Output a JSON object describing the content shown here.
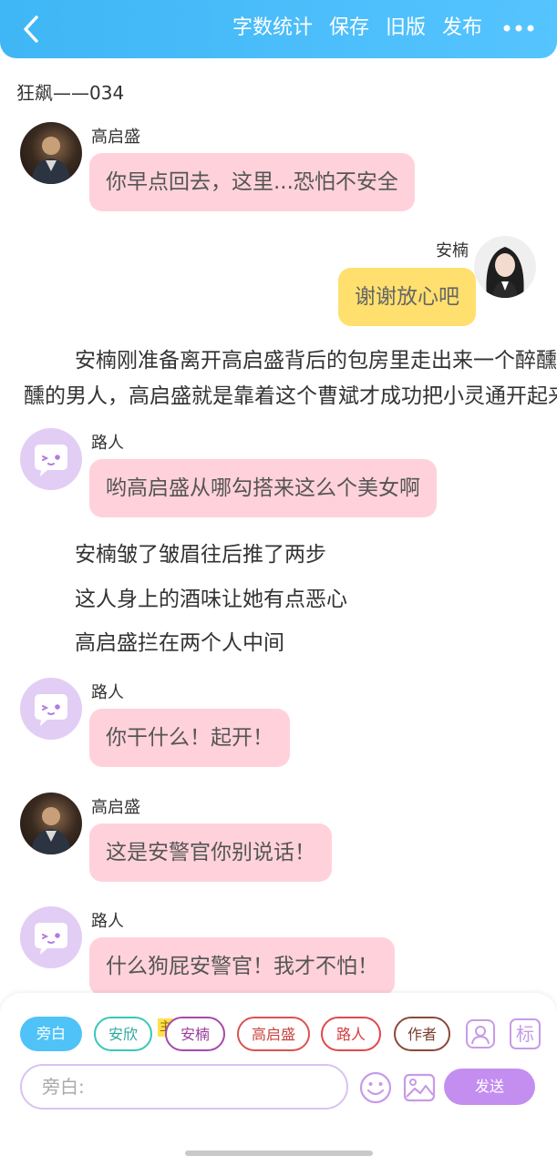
{
  "header": {
    "word_count": "字数统计",
    "save": "保存",
    "old_version": "旧版",
    "publish": "发布"
  },
  "chapter_title": "狂飙——034",
  "messages": {
    "m1": {
      "name": "高启盛",
      "text": "你早点回去，这里...恐怕不安全"
    },
    "m2": {
      "name": "安楠",
      "text": "谢谢放心吧"
    },
    "m4": {
      "name": "路人",
      "text": "哟高启盛从哪勾搭来这么个美女啊"
    },
    "m8": {
      "name": "路人",
      "text": "你干什么！起开！"
    },
    "m9": {
      "name": "高启盛",
      "text": "这是安警官你别说话！"
    },
    "m10": {
      "name": "路人",
      "text": "什么狗屁安警官！我才不怕！"
    }
  },
  "narration": {
    "n1_line1": "安楠刚准备离开高启盛背后的包房里走出来一个醉醺",
    "n1_line2": "醺的男人，高启盛就是靠着这个曹斌才成功把小灵通开起来",
    "n2": "安楠皱了皱眉往后推了两步",
    "n3": "这人身上的酒味让她有点恶心",
    "n4": "高启盛拦在两个人中间"
  },
  "roles": {
    "narrator": "旁白",
    "anxin": "安欣",
    "lead_badge": "主",
    "annan": "安楠",
    "gaoqisheng": "高启盛",
    "passerby": "路人",
    "author": "作者",
    "mark": "标"
  },
  "input": {
    "placeholder": "旁白:"
  },
  "send_label": "发送",
  "colors": {
    "header": "#46baf8",
    "pink_bubble": "#ffd2db",
    "yellow_bubble": "#ffe06e",
    "accent": "#c48ef0"
  }
}
